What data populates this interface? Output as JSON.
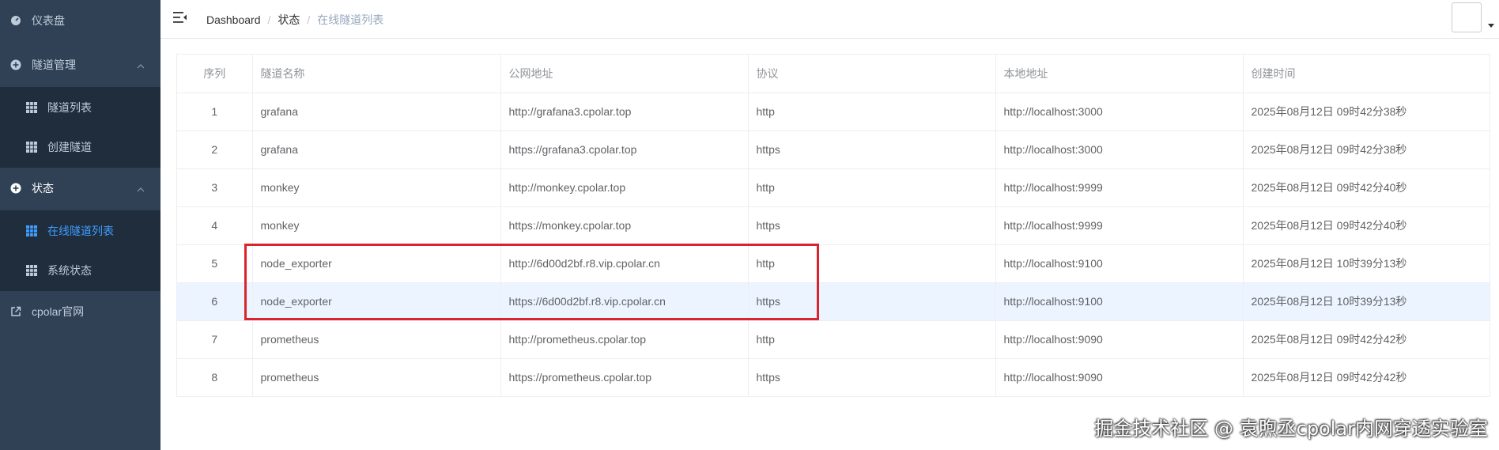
{
  "sidebar": {
    "dashboard": "仪表盘",
    "tunnel_mgmt": "隧道管理",
    "tunnel_list": "隧道列表",
    "create_tunnel": "创建隧道",
    "status": "状态",
    "online_tunnels": "在线隧道列表",
    "system_status": "系统状态",
    "cpolar_site": "cpolar官网"
  },
  "breadcrumb": {
    "home": "Dashboard",
    "sep": "/",
    "status": "状态",
    "current": "在线隧道列表"
  },
  "table": {
    "headers": [
      "序列",
      "隧道名称",
      "公网地址",
      "协议",
      "本地地址",
      "创建时间"
    ],
    "rows": [
      [
        "1",
        "grafana",
        "http://grafana3.cpolar.top",
        "http",
        "http://localhost:3000",
        "2025年08月12日 09时42分38秒"
      ],
      [
        "2",
        "grafana",
        "https://grafana3.cpolar.top",
        "https",
        "http://localhost:3000",
        "2025年08月12日 09时42分38秒"
      ],
      [
        "3",
        "monkey",
        "http://monkey.cpolar.top",
        "http",
        "http://localhost:9999",
        "2025年08月12日 09时42分40秒"
      ],
      [
        "4",
        "monkey",
        "https://monkey.cpolar.top",
        "https",
        "http://localhost:9999",
        "2025年08月12日 09时42分40秒"
      ],
      [
        "5",
        "node_exporter",
        "http://6d00d2bf.r8.vip.cpolar.cn",
        "http",
        "http://localhost:9100",
        "2025年08月12日 10时39分13秒"
      ],
      [
        "6",
        "node_exporter",
        "https://6d00d2bf.r8.vip.cpolar.cn",
        "https",
        "http://localhost:9100",
        "2025年08月12日 10时39分13秒"
      ],
      [
        "7",
        "prometheus",
        "http://prometheus.cpolar.top",
        "http",
        "http://localhost:9090",
        "2025年08月12日 09时42分42秒"
      ],
      [
        "8",
        "prometheus",
        "https://prometheus.cpolar.top",
        "https",
        "http://localhost:9090",
        "2025年08月12日 09时42分42秒"
      ]
    ]
  },
  "watermark": "掘金技术社区 @ 袁煦丞cpolar内网穿透实验室",
  "colors": {
    "sidebar_bg": "#304156",
    "submenu_bg": "#1f2d3d",
    "active": "#409eff",
    "highlight_box": "#d9232d"
  }
}
